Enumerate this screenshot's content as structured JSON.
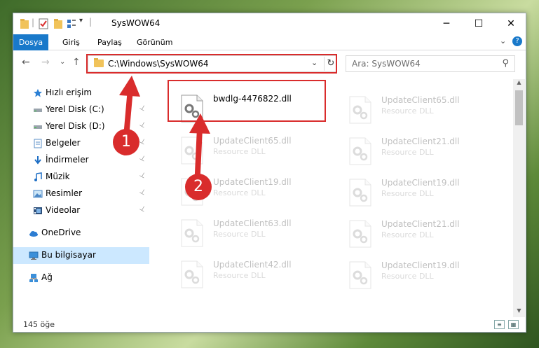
{
  "window": {
    "title": "SysWOW64",
    "minimize_glyph": "─",
    "maximize_glyph": "☐",
    "close_glyph": "✕"
  },
  "ribbon": {
    "tabs": [
      "Dosya",
      "Giriş",
      "Paylaş",
      "Görünüm"
    ],
    "help_glyph": "?",
    "expand_glyph": "⌄"
  },
  "address": {
    "path": "C:\\Windows\\SysWOW64",
    "chevron_glyph": "⌄",
    "refresh_glyph": "↻"
  },
  "search": {
    "placeholder": "Ara: SysWOW64"
  },
  "nav": {
    "back_glyph": "←",
    "forward_glyph": "→",
    "recent_glyph": "⌄",
    "up_glyph": "↑"
  },
  "sidebar": {
    "items": [
      {
        "label": "Hızlı erişim",
        "icon": "star-icon",
        "pinned": false,
        "selected": false
      },
      {
        "label": "Yerel Disk (C:)",
        "icon": "drive-icon",
        "pinned": true,
        "selected": false
      },
      {
        "label": "Yerel Disk (D:)",
        "icon": "drive-icon",
        "pinned": true,
        "selected": false
      },
      {
        "label": "Belgeler",
        "icon": "documents-icon",
        "pinned": true,
        "selected": false
      },
      {
        "label": "İndirmeler",
        "icon": "downloads-icon",
        "pinned": true,
        "selected": false
      },
      {
        "label": "Müzik",
        "icon": "music-icon",
        "pinned": true,
        "selected": false
      },
      {
        "label": "Resimler",
        "icon": "pictures-icon",
        "pinned": true,
        "selected": false
      },
      {
        "label": "Videolar",
        "icon": "videos-icon",
        "pinned": true,
        "selected": false
      },
      {
        "label": "OneDrive",
        "icon": "cloud-icon",
        "pinned": false,
        "selected": false
      },
      {
        "label": "Bu bilgisayar",
        "icon": "computer-icon",
        "pinned": false,
        "selected": true
      },
      {
        "label": "Ağ",
        "icon": "network-icon",
        "pinned": false,
        "selected": false
      }
    ],
    "pin_glyph": "📌"
  },
  "files": {
    "highlighted": {
      "name": "bwdlg-4476822.dll"
    },
    "left_column": [
      {
        "name": "UpdateClient65.dll",
        "type": "Resource DLL"
      },
      {
        "name": "UpdateClient19.dll",
        "type": "Resource DLL"
      },
      {
        "name": "UpdateClient63.dll",
        "type": "Resource DLL"
      },
      {
        "name": "UpdateClient42.dll",
        "type": "Resource DLL"
      }
    ],
    "right_column": [
      {
        "name": "UpdateClient65.dll",
        "type": "Resource DLL"
      },
      {
        "name": "UpdateClient21.dll",
        "type": "Resource DLL"
      },
      {
        "name": "UpdateClient19.dll",
        "type": "Resource DLL"
      },
      {
        "name": "UpdateClient21.dll",
        "type": "Resource DLL"
      },
      {
        "name": "UpdateClient19.dll",
        "type": "Resource DLL"
      }
    ]
  },
  "status": {
    "item_count": "145 öğe"
  },
  "annotations": {
    "step1": "1",
    "step2": "2",
    "color": "#d92c2c"
  },
  "colors": {
    "accent": "#1979ca",
    "selection": "#cce8ff",
    "highlight": "#d92c2c"
  }
}
